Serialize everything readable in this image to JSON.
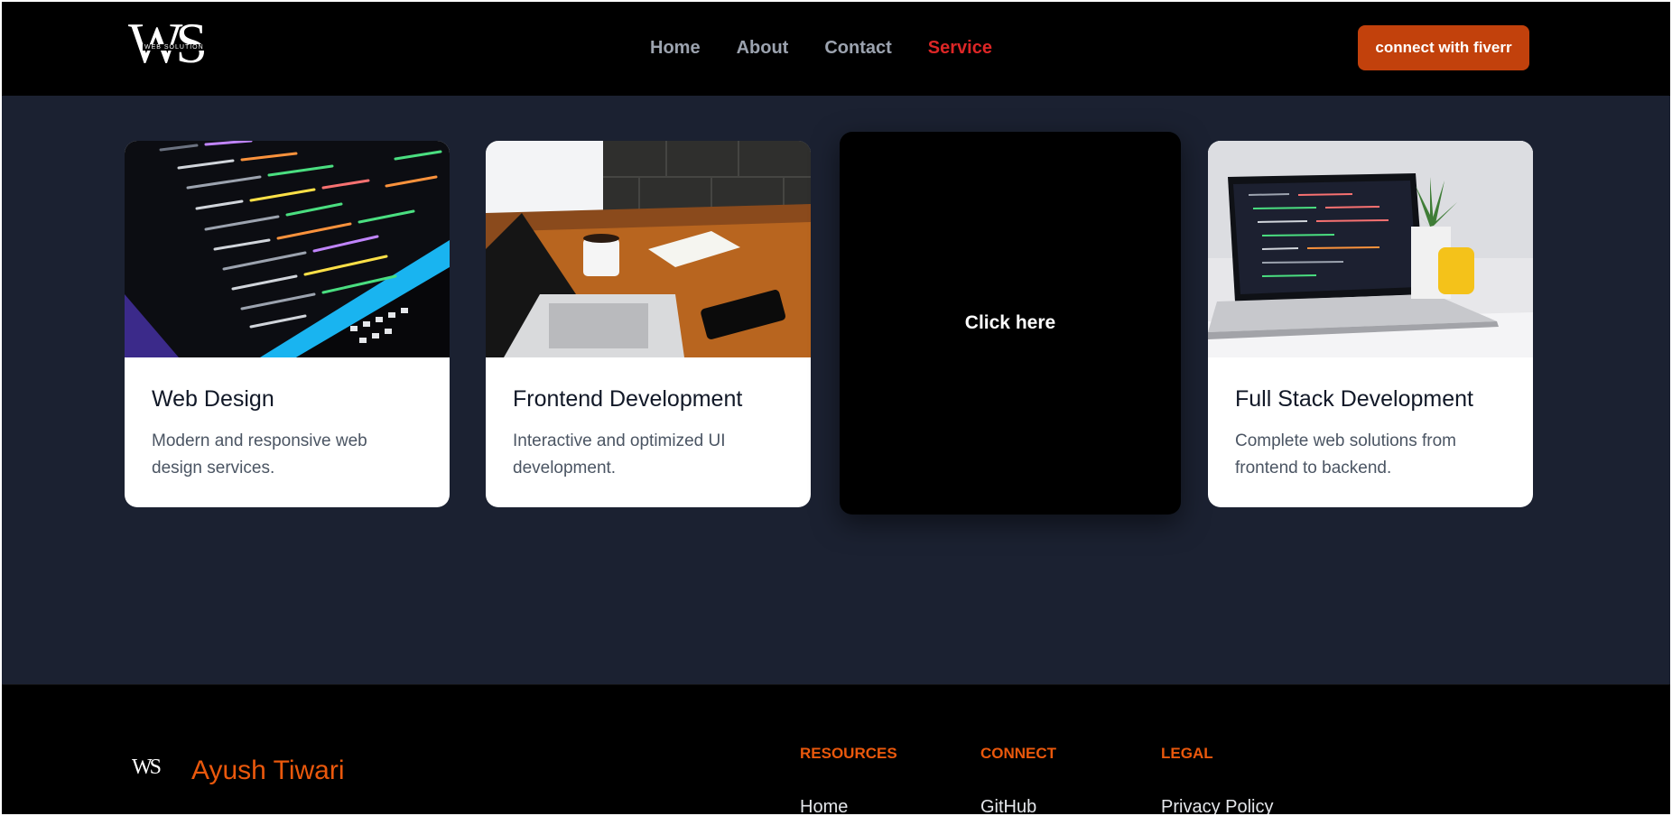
{
  "nav": {
    "logo_mark": "WS",
    "logo_sub": "WEB SOLUTION",
    "links": [
      {
        "label": "Home"
      },
      {
        "label": "About"
      },
      {
        "label": "Contact"
      },
      {
        "label": "Service",
        "active": true
      }
    ],
    "cta_label": "connect with fiverr"
  },
  "services": [
    {
      "title": "Web Design",
      "description": "Modern and responsive web design services.",
      "image": "code-screen-image"
    },
    {
      "title": "Frontend Development",
      "description": "Interactive and optimized UI development.",
      "image": "desk-laptop-image"
    },
    {
      "title": "",
      "description": "",
      "overlay_label": "Click here"
    },
    {
      "title": "Full Stack Development",
      "description": "Complete web solutions from frontend to backend.",
      "image": "laptop-code-image"
    }
  ],
  "footer": {
    "logo_mark": "WS",
    "name": "Ayush Tiwari",
    "columns": [
      {
        "heading": "RESOURCES",
        "first_link": "Home"
      },
      {
        "heading": "CONNECT",
        "first_link": "GitHub"
      },
      {
        "heading": "LEGAL",
        "first_link": "Privacy Policy"
      }
    ]
  },
  "colors": {
    "accent": "#c2410c",
    "active_link": "#dc2626",
    "footer_accent": "#ea580c",
    "background": "#1b2131"
  }
}
